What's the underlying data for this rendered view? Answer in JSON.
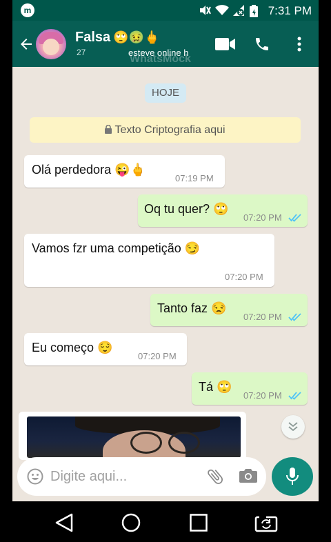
{
  "status_bar": {
    "time": "7:31 PM",
    "app_icon_letter": "m"
  },
  "header": {
    "contact_name": "Falsa",
    "name_emojis": "🙄🤢🖕",
    "subtitle_left": "27",
    "subtitle_status": "esteve online h",
    "watermark": "WhatsMock"
  },
  "chat": {
    "date_label": "HOJE",
    "encryption_notice": "Texto Criptografia aqui",
    "messages": [
      {
        "direction": "in",
        "text": "Olá perdedora 😜🖕",
        "time": "07:19 PM"
      },
      {
        "direction": "out",
        "text": "Oq tu quer? 🙄",
        "time": "07:20 PM"
      },
      {
        "direction": "in",
        "text": "Vamos fzr uma competição 😏",
        "time": "07:20 PM"
      },
      {
        "direction": "out",
        "text": "Tanto faz 😒",
        "time": "07:20 PM"
      },
      {
        "direction": "in",
        "text": "Eu começo 😌",
        "time": "07:20 PM"
      },
      {
        "direction": "out",
        "text": "Tá 🙄",
        "time": "07:20 PM"
      }
    ]
  },
  "input": {
    "placeholder": "Digite aqui..."
  },
  "colors": {
    "header": "#075e54",
    "status_bar": "#00574b",
    "chat_bg": "#ece5dd",
    "outgoing_bubble": "#dcf8c6",
    "incoming_bubble": "#ffffff",
    "accent": "#128c7e",
    "read_ticks": "#4fc3f7"
  },
  "icons": [
    "back-arrow-icon",
    "video-call-icon",
    "phone-icon",
    "more-vert-icon",
    "emoji-icon",
    "attach-icon",
    "camera-icon",
    "mic-icon",
    "chevron-down-icon",
    "lock-icon",
    "mute-icon",
    "wifi-icon",
    "signal-icon",
    "battery-icon",
    "nav-back-icon",
    "nav-home-icon",
    "nav-recents-icon",
    "screen-rotate-icon"
  ]
}
